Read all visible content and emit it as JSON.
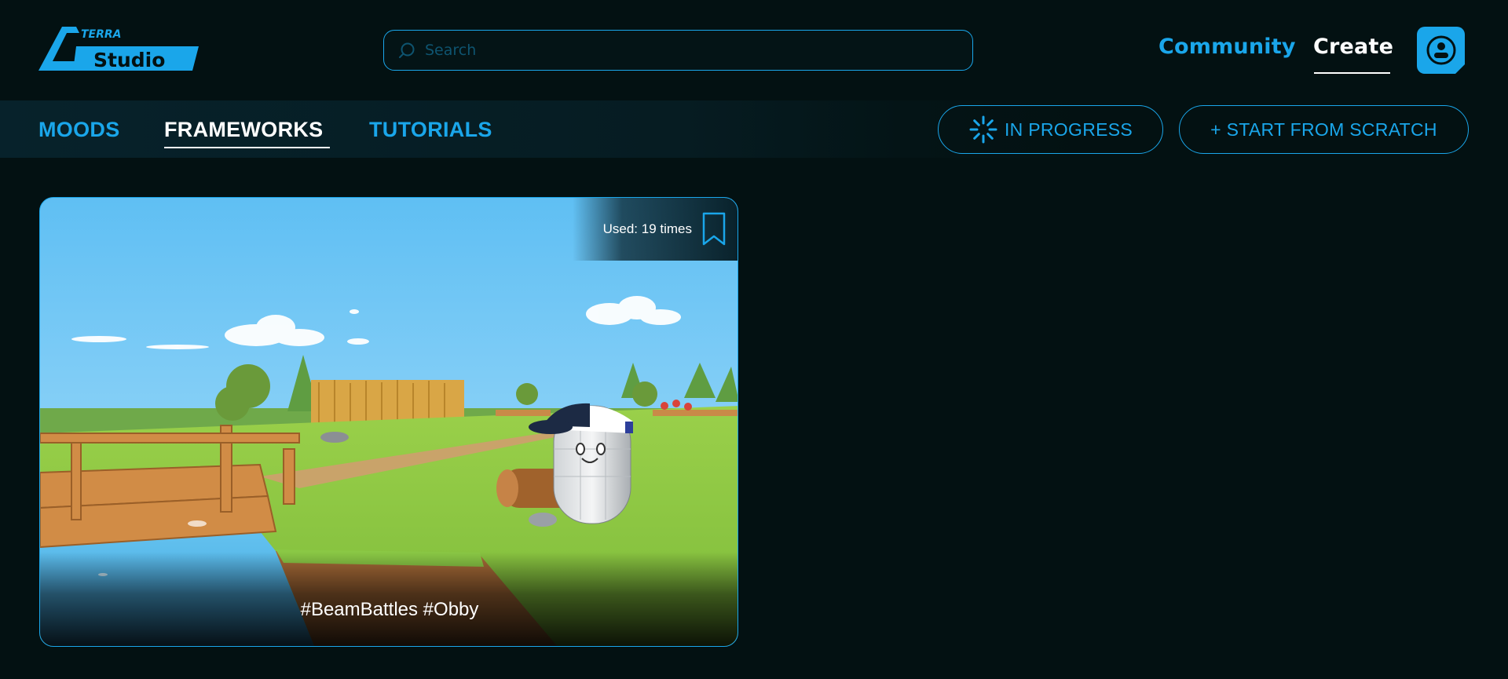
{
  "header": {
    "logo": {
      "small_text": "TERRA",
      "big_text": "Studio"
    },
    "search": {
      "placeholder": "Search",
      "value": ""
    },
    "nav": {
      "community": "Community",
      "create": "Create"
    }
  },
  "tabs": [
    {
      "label": "MOODS",
      "active": false
    },
    {
      "label": "FRAMEWORKS",
      "active": true
    },
    {
      "label": "TUTORIALS",
      "active": false
    }
  ],
  "actions": {
    "in_progress": "IN PROGRESS",
    "start_from_scratch": "+ START FROM SCRATCH"
  },
  "cards": [
    {
      "used": "Used: 19 times",
      "tags": "#BeamBattles #Obby",
      "image_description_icon": "game-scene-thumbnail"
    }
  ],
  "colors": {
    "background": "#031112",
    "accent": "#1aa6ea",
    "text": "#ffffff"
  }
}
